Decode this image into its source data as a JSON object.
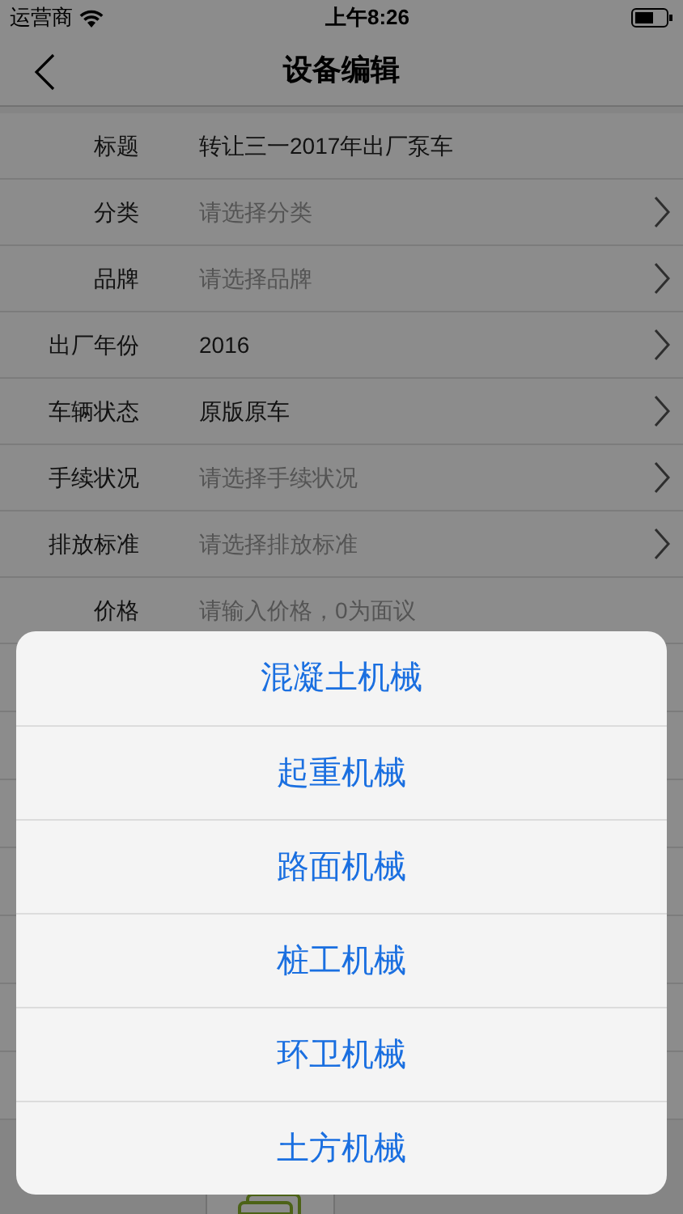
{
  "status_bar": {
    "carrier": "运营商",
    "time": "上午8:26"
  },
  "nav_bar": {
    "title": "设备编辑"
  },
  "form": {
    "rows": [
      {
        "kind": "text",
        "label": "标题",
        "value": "转让三一2017年出厂泵车"
      },
      {
        "kind": "select",
        "label": "分类",
        "placeholder": "请选择分类"
      },
      {
        "kind": "select",
        "label": "品牌",
        "placeholder": "请选择品牌"
      },
      {
        "kind": "select",
        "label": "出厂年份",
        "value": "2016"
      },
      {
        "kind": "select",
        "label": "车辆状态",
        "value": "原版原车"
      },
      {
        "kind": "select",
        "label": "手续状况",
        "placeholder": "请选择手续状况"
      },
      {
        "kind": "select",
        "label": "排放标准",
        "placeholder": "请选择排放标准"
      },
      {
        "kind": "text",
        "label": "价格",
        "placeholder": "请输入价格，0为面议"
      }
    ]
  },
  "action_sheet": {
    "options": [
      "混凝土机械",
      "起重机械",
      "路面机械",
      "桩工机械",
      "环卫机械",
      "土方机械"
    ]
  }
}
